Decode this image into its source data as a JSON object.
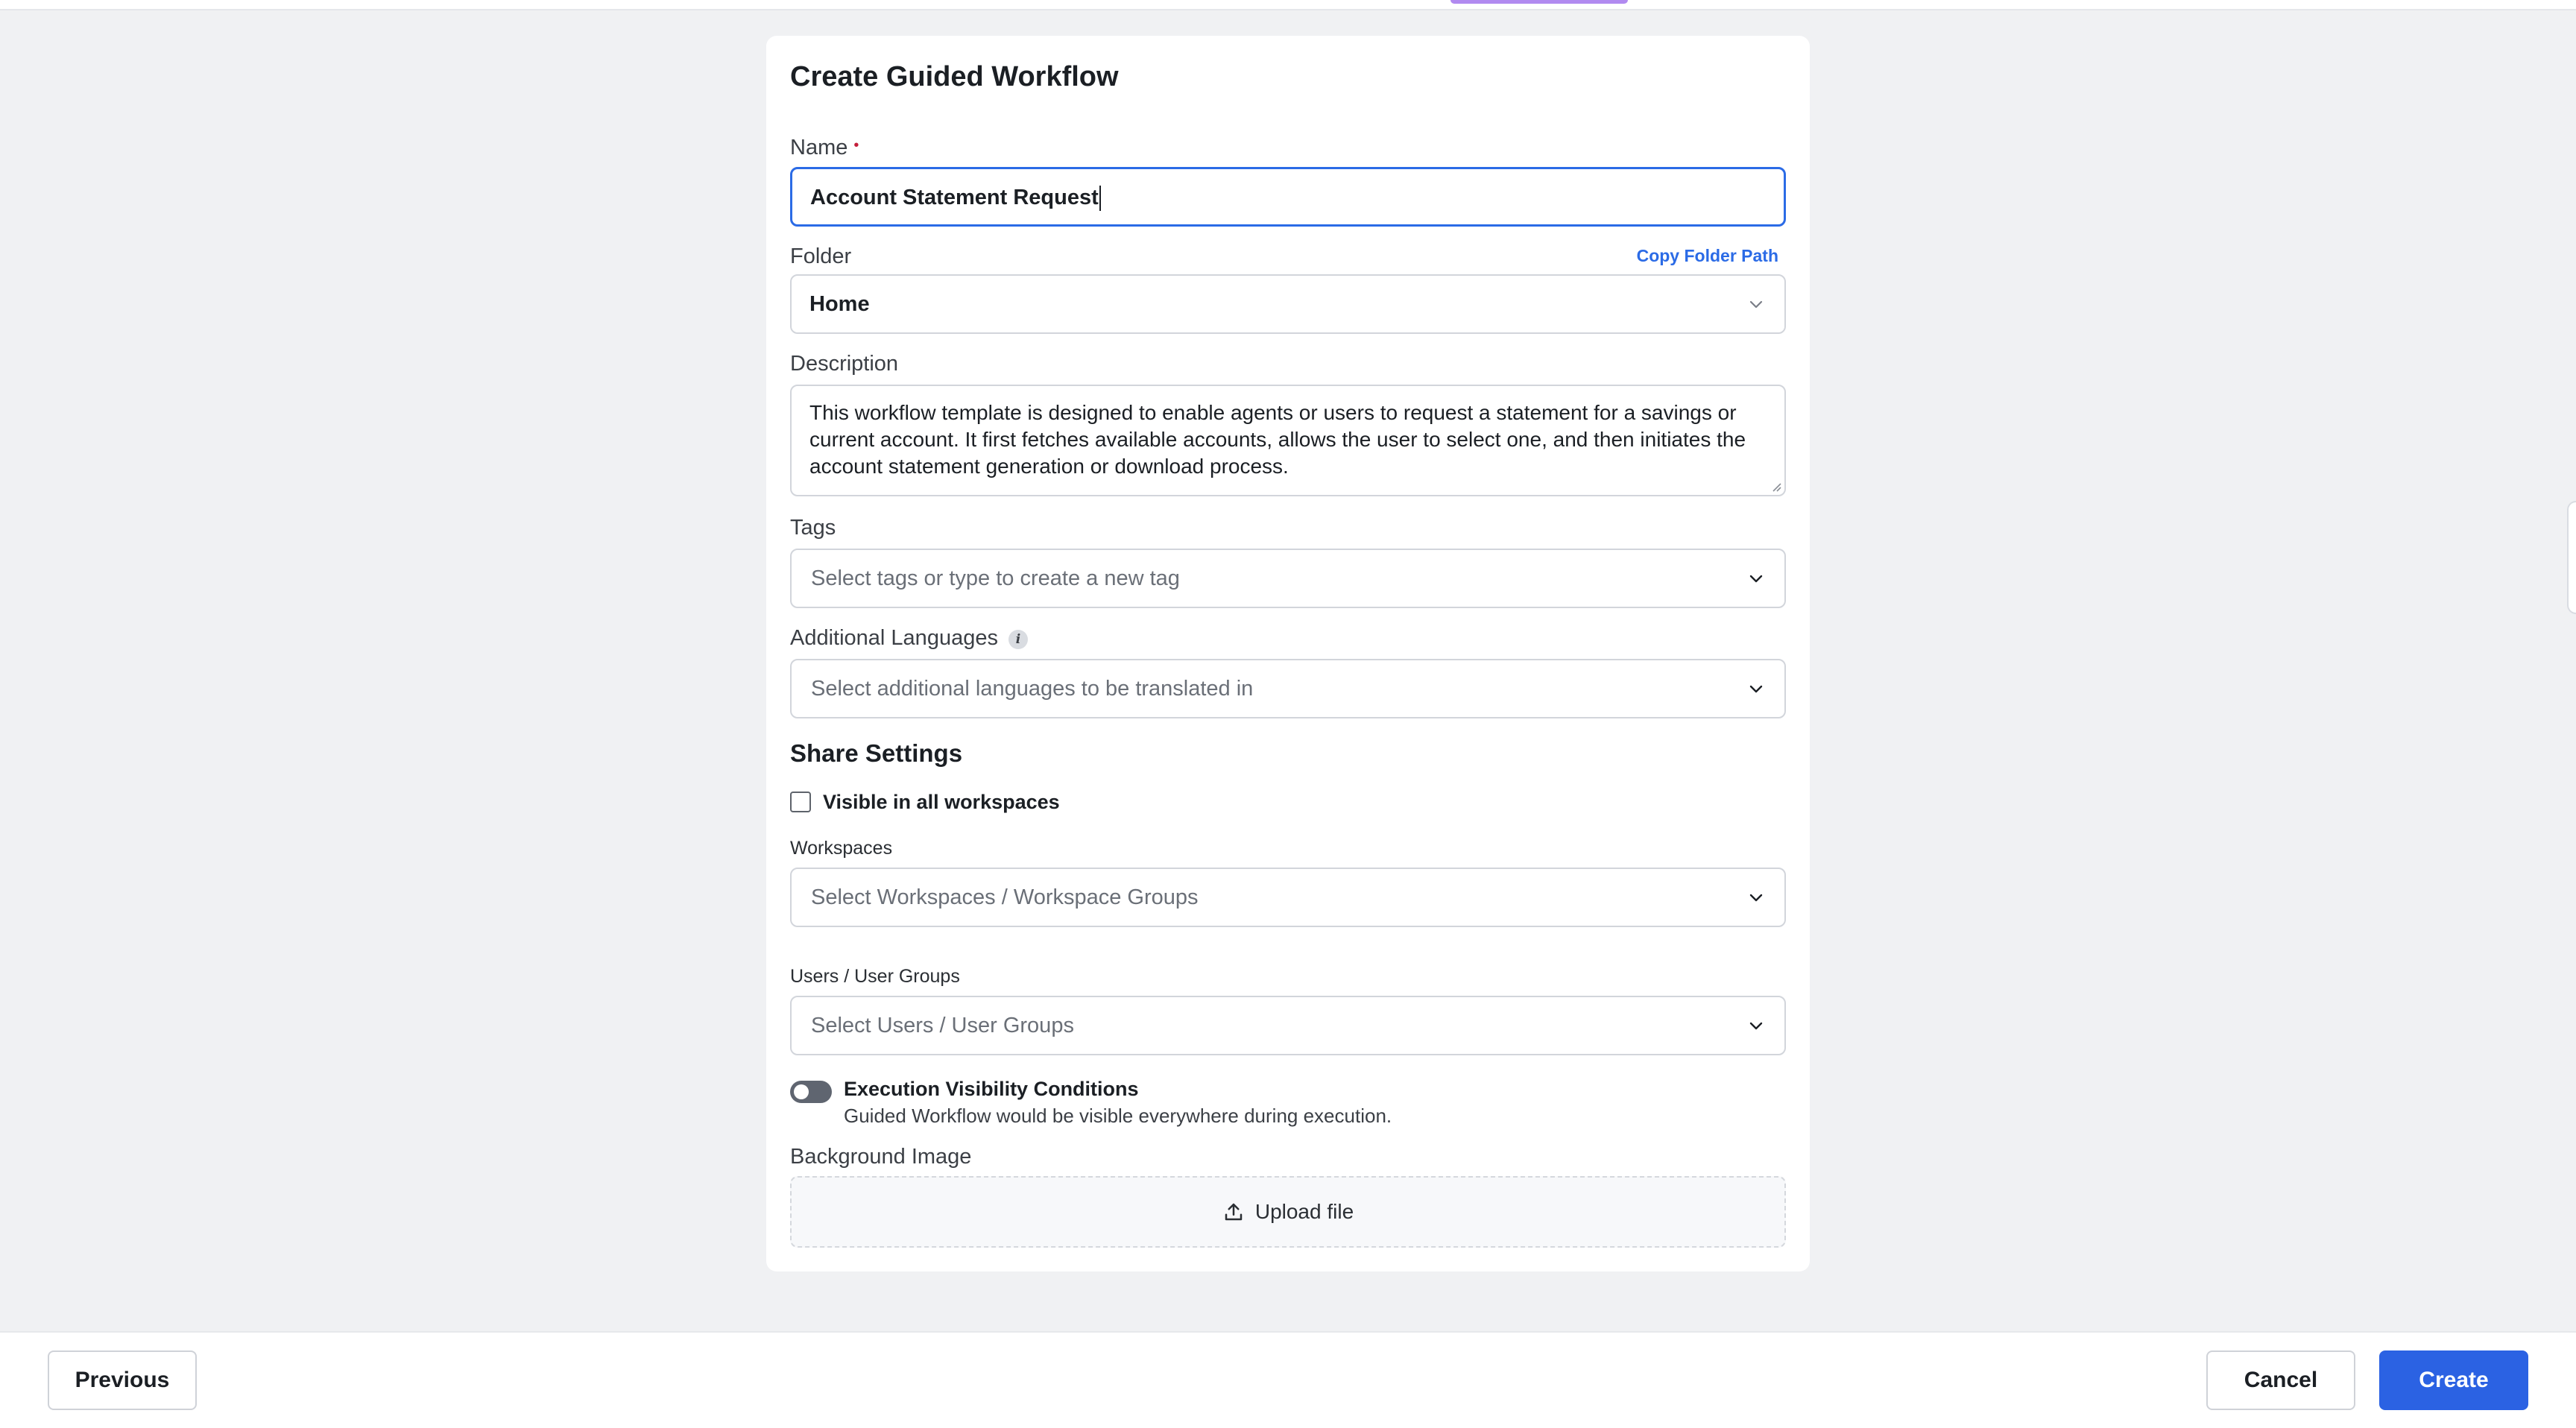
{
  "modal": {
    "title": "Create Guided Workflow",
    "name": {
      "label": "Name",
      "required_mark": "•",
      "value": "Account Statement Request"
    },
    "folder": {
      "label": "Folder",
      "copy_link": "Copy Folder Path",
      "value": "Home"
    },
    "description": {
      "label": "Description",
      "value": "This workflow template is designed to enable agents or users to request a statement for a savings or current account. It first fetches available accounts, allows the user to select one, and then initiates the account statement generation or download process."
    },
    "tags": {
      "label": "Tags",
      "placeholder": "Select tags or type to create a new tag"
    },
    "languages": {
      "label": "Additional Languages",
      "info_icon": "i",
      "placeholder": "Select additional languages to be translated in"
    },
    "share": {
      "title": "Share Settings",
      "visible_all_label": "Visible in all workspaces",
      "visible_all_checked": false,
      "workspaces": {
        "label": "Workspaces",
        "placeholder": "Select Workspaces / Workspace Groups"
      },
      "users": {
        "label": "Users / User Groups",
        "placeholder": "Select Users / User Groups"
      }
    },
    "execution": {
      "enabled": false,
      "title": "Execution Visibility Conditions",
      "description": "Guided Workflow would be visible everywhere during execution."
    },
    "background": {
      "label": "Background Image",
      "upload_label": "Upload file"
    }
  },
  "footer": {
    "previous": "Previous",
    "cancel": "Cancel",
    "create": "Create"
  },
  "colors": {
    "accent": "#2b62e3",
    "link": "#2b6be6",
    "required": "#c41e3a"
  }
}
